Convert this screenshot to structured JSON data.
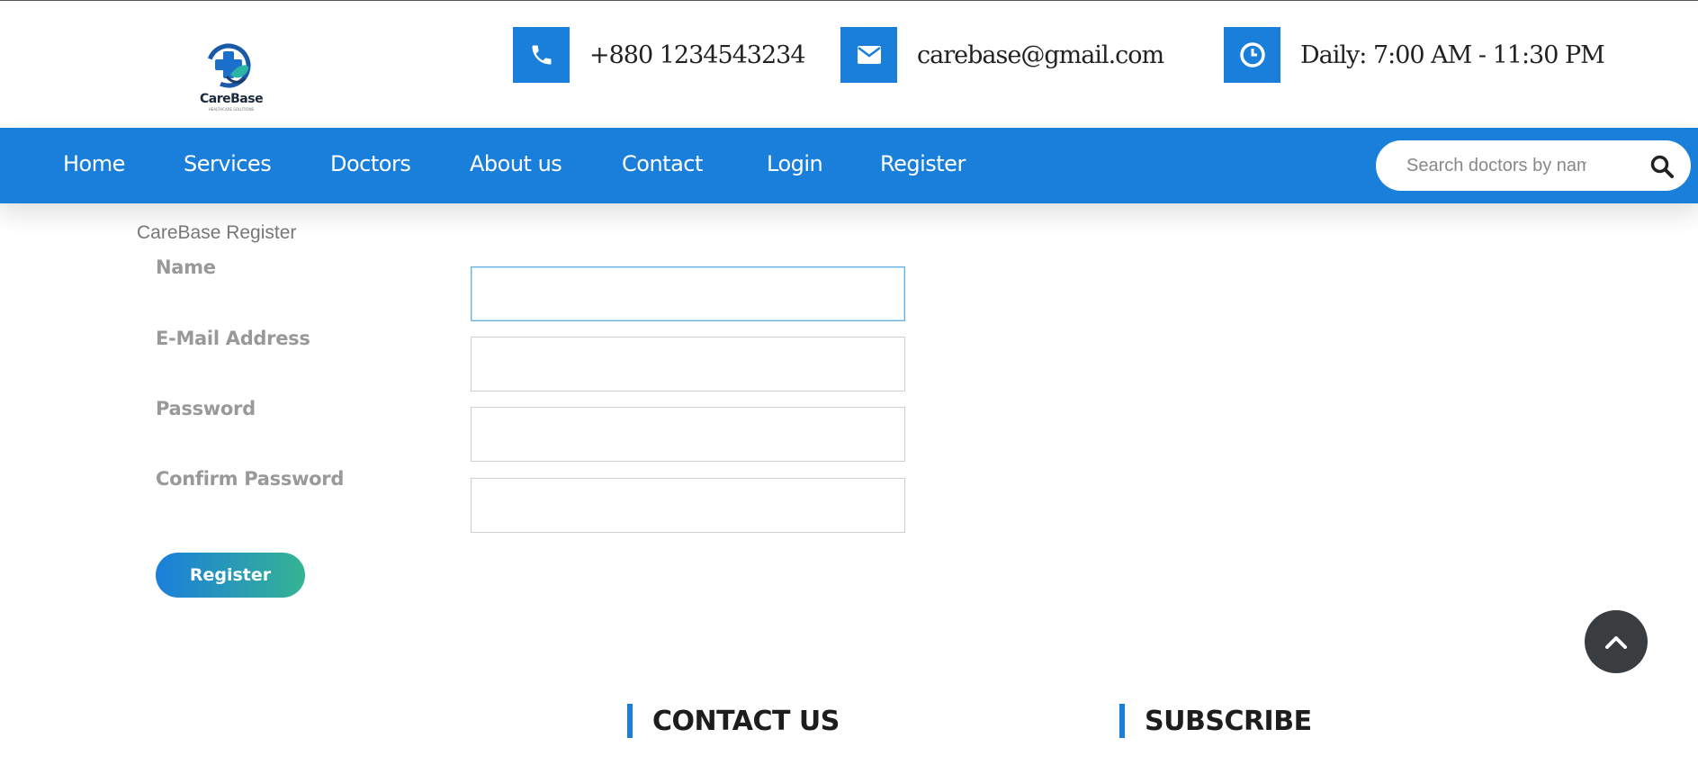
{
  "brand": {
    "name": "CareBase",
    "tagline": "HEALTHCARE SOLUTIONS"
  },
  "header": {
    "phone": "+880 1234543234",
    "email": "carebase@gmail.com",
    "hours": "Daily: 7:00 AM - 11:30 PM",
    "phone_icon": "phone-icon",
    "email_icon": "envelope-icon",
    "hours_icon": "clock-icon"
  },
  "nav": {
    "items": [
      {
        "label": "Home"
      },
      {
        "label": "Services"
      },
      {
        "label": "Doctors"
      },
      {
        "label": "About us"
      },
      {
        "label": "Contact"
      },
      {
        "label": "Login"
      },
      {
        "label": "Register"
      }
    ],
    "search_placeholder": "Search doctors by name",
    "search_icon": "search-icon"
  },
  "form": {
    "title": "CareBase Register",
    "fields": [
      {
        "label": "Name",
        "value": ""
      },
      {
        "label": "E-Mail Address",
        "value": ""
      },
      {
        "label": "Password",
        "value": ""
      },
      {
        "label": "Confirm Password",
        "value": ""
      }
    ],
    "submit_label": "Register"
  },
  "footer": {
    "contact_heading": "CONTACT US",
    "subscribe_heading": "SUBSCRIBE"
  },
  "colors": {
    "primary": "#1a7fdb",
    "accent": "#35b394",
    "dark": "#3a3d40"
  }
}
